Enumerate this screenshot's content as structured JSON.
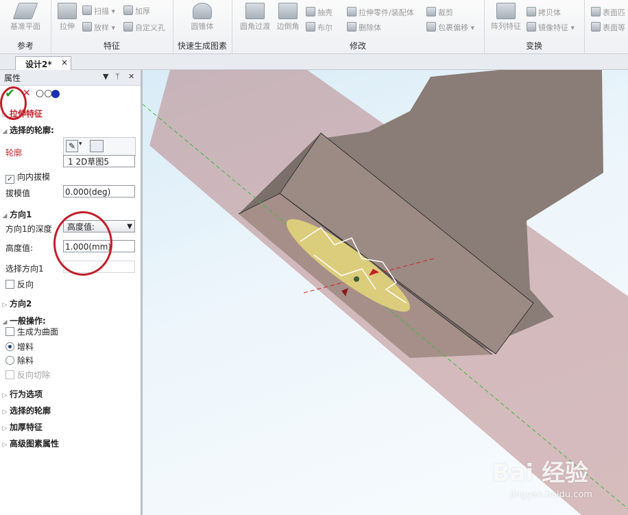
{
  "ribbon": {
    "groups": [
      {
        "label": "参考"
      },
      {
        "label": "特征"
      },
      {
        "label": "快速生成图素"
      },
      {
        "label": "修改"
      },
      {
        "label": "变换"
      }
    ],
    "buttons": {
      "base_plane": "基准平面",
      "extrude": "拉伸",
      "sweep": "扫描",
      "loft": "放样",
      "thicken": "加厚",
      "custom_hole": "自定义孔",
      "cone": "圆锥体",
      "fillet": "圆角过渡",
      "chamfer": "边倒角",
      "shell": "抽壳",
      "boolean": "布尔",
      "extrude_part": "拉伸零件/装配体",
      "delete_body": "删除体",
      "trim": "裁剪",
      "wrap_offset": "包裹偏移",
      "pattern": "阵列特征",
      "copy_body": "拷贝体",
      "mirror": "镜像特征",
      "surface_a": "表面匹",
      "surface_b": "表面等"
    }
  },
  "document_tab": {
    "title": "设计2*",
    "close": "×"
  },
  "panel": {
    "title": "属性",
    "pin": "▼",
    "pin2": "ᛘ",
    "close": "✕",
    "feature_title": "拉伸特征",
    "section_profile": "选择的轮廓:",
    "profile_label": "轮廓",
    "profile_value": "1    2D草图5",
    "inward_draft": "向内拔模",
    "draft_label": "拔模值",
    "draft_value": "0.000(deg)",
    "section_dir1": "方向1",
    "dir1_depth_label": "方向1的深度",
    "dir1_depth_value": "高度值:",
    "height_label": "高度值:",
    "height_value": "1.000(mm)",
    "select_dir1": "选择方向1",
    "reverse": "反向",
    "section_dir2": "方向2",
    "section_general": "一般操作:",
    "as_surface": "生成为曲面",
    "add_material": "增料",
    "remove_material": "除料",
    "reverse_cut": "反向切除",
    "behavior": "行为选项",
    "selected_profile": "选择的轮廓",
    "thicken_feature": "加厚特征",
    "advanced": "高级图素属性"
  },
  "watermark": {
    "brand": "Bai 经验",
    "url": "jingyan.baidu.com"
  },
  "colors": {
    "accent_red": "#c21d2a",
    "check_green": "#1f9a2b"
  }
}
